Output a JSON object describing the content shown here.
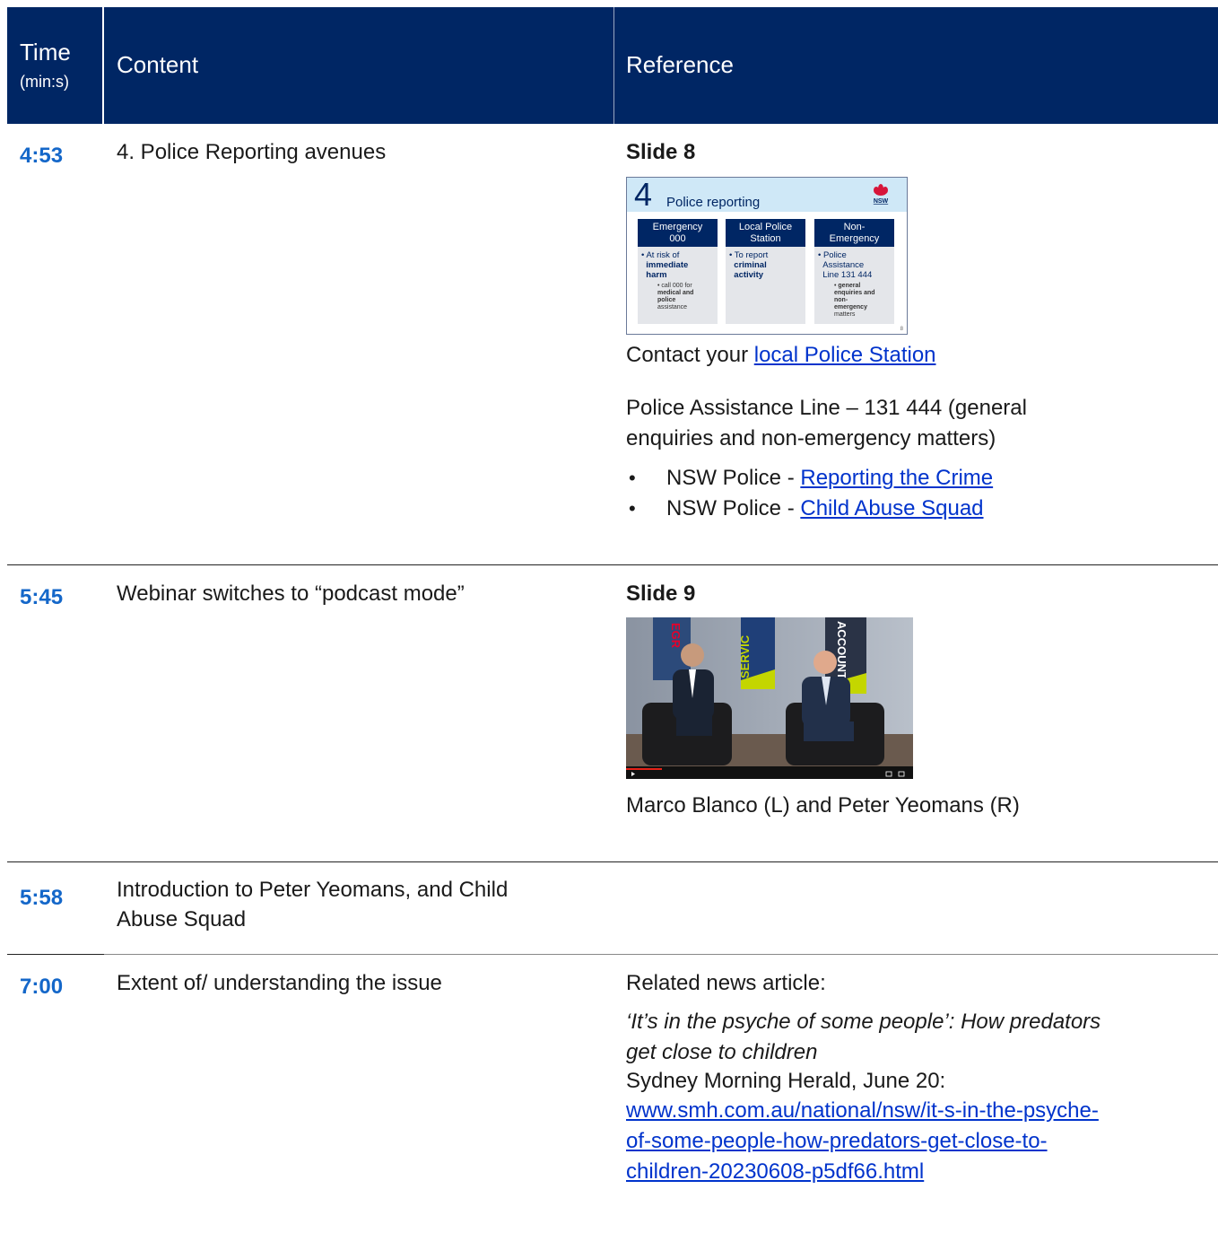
{
  "header": {
    "time_label": "Time",
    "time_sub": "(min:s)",
    "content_label": "Content",
    "reference_label": "Reference"
  },
  "rows": [
    {
      "time": "4:53",
      "content": "4. Police Reporting avenues",
      "slide_label": "Slide 8",
      "slide": {
        "number": "4",
        "title": "Police reporting",
        "logo_text": "NSW",
        "columns": [
          {
            "head1": "Emergency",
            "head2": "000",
            "b1": "At risk of",
            "b2": "immediate",
            "b3": "harm",
            "s1": "call 000 for",
            "s2": "medical and",
            "s3": "police",
            "s4": "assistance"
          },
          {
            "head1": "Local Police",
            "head2": "Station",
            "b1": "To report",
            "b2": "criminal",
            "b3": "activity"
          },
          {
            "head1": "Non-",
            "head2": "Emergency",
            "b1": "Police",
            "b2": "Assistance",
            "b3": "Line 131 444",
            "s1": "general",
            "s2": "enquiries and",
            "s3": "non-",
            "s4": "emergency",
            "s5": "matters"
          }
        ],
        "page": "8"
      },
      "contact_prefix": "Contact your ",
      "contact_link": "local Police Station",
      "pal_line1": "Police Assistance Line – 131 444 (general",
      "pal_line2": "enquiries and non-emergency matters)",
      "bullets": [
        {
          "prefix": "NSW Police - ",
          "link": "Reporting the Crime"
        },
        {
          "prefix": "NSW Police - ",
          "link": "Child Abuse Squad"
        }
      ]
    },
    {
      "time": "5:45",
      "content": "Webinar switches to “podcast mode”",
      "slide_label": "Slide 9",
      "video_banners": [
        "EGR",
        "SERVIC",
        "ACCOUNT"
      ],
      "caption": "Marco Blanco (L) and Peter Yeomans (R)"
    },
    {
      "time": "5:58",
      "content_line1": "Introduction to Peter Yeomans, and Child",
      "content_line2": "Abuse Squad"
    },
    {
      "time": "7:00",
      "content": "Extent of/ understanding the issue",
      "related_label": "Related news article:",
      "article_title_1": "‘It’s in the psyche of some people’: How predators",
      "article_title_2": "get close to children",
      "source": "Sydney Morning Herald, June 20:",
      "url_1": "www.smh.com.au/national/nsw/it-s-in-the-psyche-",
      "url_2": "of-some-people-how-predators-get-close-to-",
      "url_3": "children-20230608-p5df66.html"
    }
  ],
  "colors": {
    "header_bg": "#002664",
    "time_text": "#1467c9",
    "link": "#0033cc"
  }
}
